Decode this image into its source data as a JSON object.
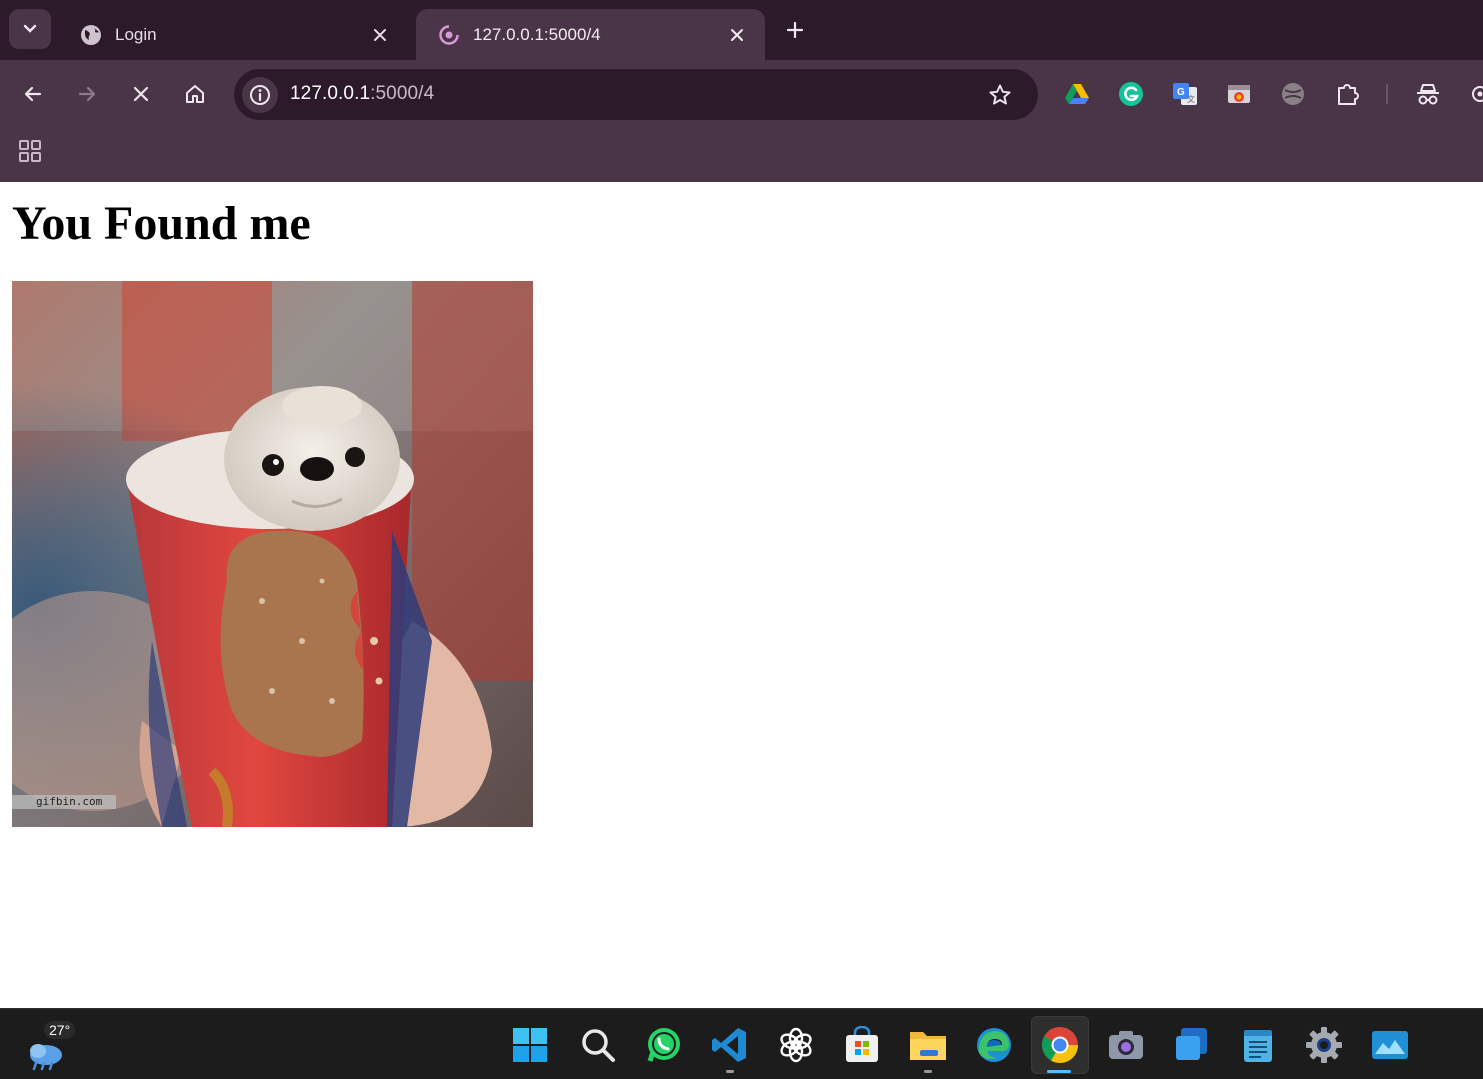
{
  "browser": {
    "tabs": [
      {
        "title": "Login",
        "favicon": "globe-icon",
        "active": false
      },
      {
        "title": "127.0.0.1:5000/4",
        "favicon": "chrome-loading-icon",
        "active": true
      }
    ],
    "address_bar": {
      "url_host": "127.0.0.1",
      "url_rest": ":5000/4"
    },
    "extensions": [
      "google-drive-icon",
      "grammarly-icon",
      "google-translate-icon",
      "screenshot-extension-icon",
      "vpn-extension-icon",
      "extensions-puzzle-icon",
      "incognito-icon"
    ]
  },
  "page": {
    "heading": "You Found me",
    "image": {
      "description_icon": "puppy-in-cup-image",
      "watermark": "gifbin.com"
    }
  },
  "taskbar": {
    "weather_temp": "27°",
    "apps": [
      "start-icon",
      "search-icon",
      "whatsapp-icon",
      "vscode-icon",
      "chatgpt-icon",
      "microsoft-store-icon",
      "file-explorer-icon",
      "edge-icon",
      "chrome-icon",
      "camera-icon",
      "windows-app-icon",
      "notepad-icon",
      "settings-icon",
      "photos-icon"
    ]
  }
}
